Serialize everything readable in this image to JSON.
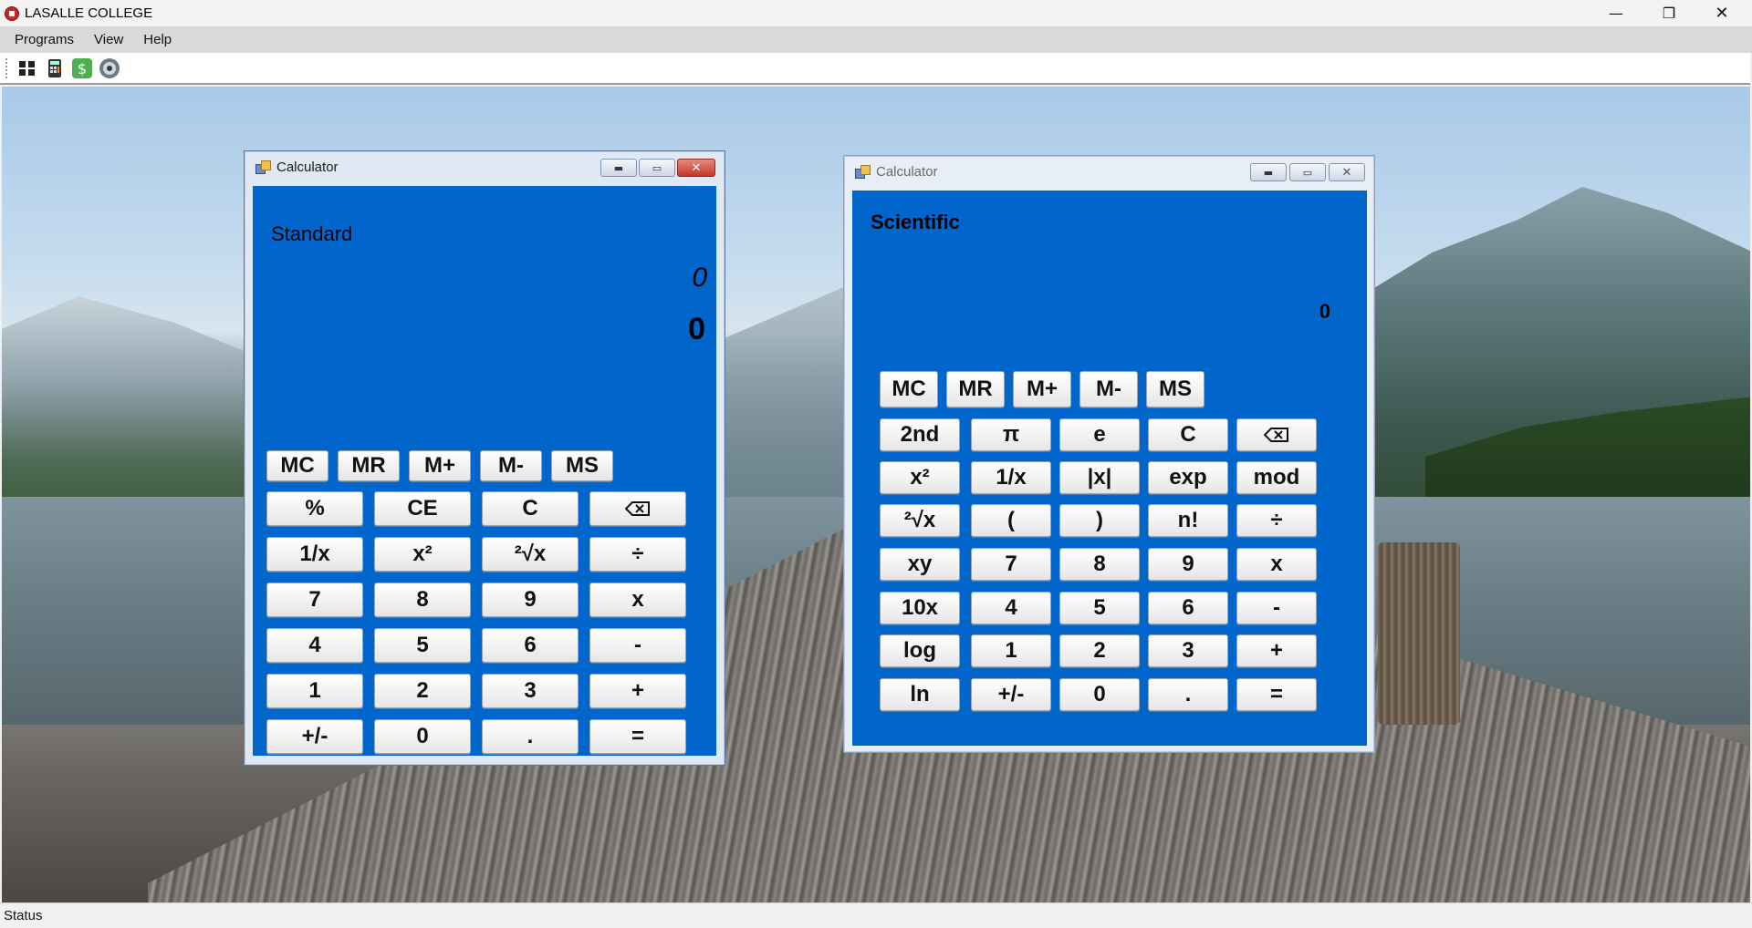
{
  "app": {
    "title": "LASALLE COLLEGE"
  },
  "window_controls": {
    "minimize": "—",
    "maximize": "❐",
    "close": "✕"
  },
  "menu": {
    "items": [
      "Programs",
      "View",
      "Help"
    ]
  },
  "toolbar": {
    "buttons": [
      "grid-icon",
      "calculator-icon",
      "money-icon",
      "disc-icon"
    ]
  },
  "status": {
    "text": "Status"
  },
  "standard_calc": {
    "title": "Calculator",
    "controls": {
      "minimize": "▬",
      "maximize": "▭",
      "close": "✕"
    },
    "mode": "Standard",
    "expression": "0",
    "result": "0",
    "memory_keys": [
      "MC",
      "MR",
      "M+",
      "M-",
      "MS"
    ],
    "keys": [
      [
        "%",
        "CE",
        "C",
        "⌫"
      ],
      [
        "1/x",
        "x²",
        "²√x",
        "÷"
      ],
      [
        "7",
        "8",
        "9",
        "x"
      ],
      [
        "4",
        "5",
        "6",
        "-"
      ],
      [
        "1",
        "2",
        "3",
        "+"
      ],
      [
        "+/-",
        "0",
        ".",
        "="
      ]
    ]
  },
  "scientific_calc": {
    "title": "Calculator",
    "controls": {
      "minimize": "▬",
      "maximize": "▭",
      "close": "✕"
    },
    "mode": "Scientific",
    "result": "0",
    "memory_keys": [
      "MC",
      "MR",
      "M+",
      "M-",
      "MS"
    ],
    "keys": [
      [
        "2nd",
        "π",
        "e",
        "C",
        "⌫"
      ],
      [
        "x²",
        "1/x",
        "|x|",
        "exp",
        "mod"
      ],
      [
        "²√x",
        "(",
        ")",
        "n!",
        "÷"
      ],
      [
        "xy",
        "7",
        "8",
        "9",
        "x"
      ],
      [
        "10x",
        "4",
        "5",
        "6",
        "-"
      ],
      [
        "log",
        "1",
        "2",
        "3",
        "+"
      ],
      [
        "ln",
        "+/-",
        "0",
        ".",
        "="
      ]
    ]
  },
  "colors": {
    "calc_body": "#0066cc",
    "menubar": "#d9d9d9"
  }
}
